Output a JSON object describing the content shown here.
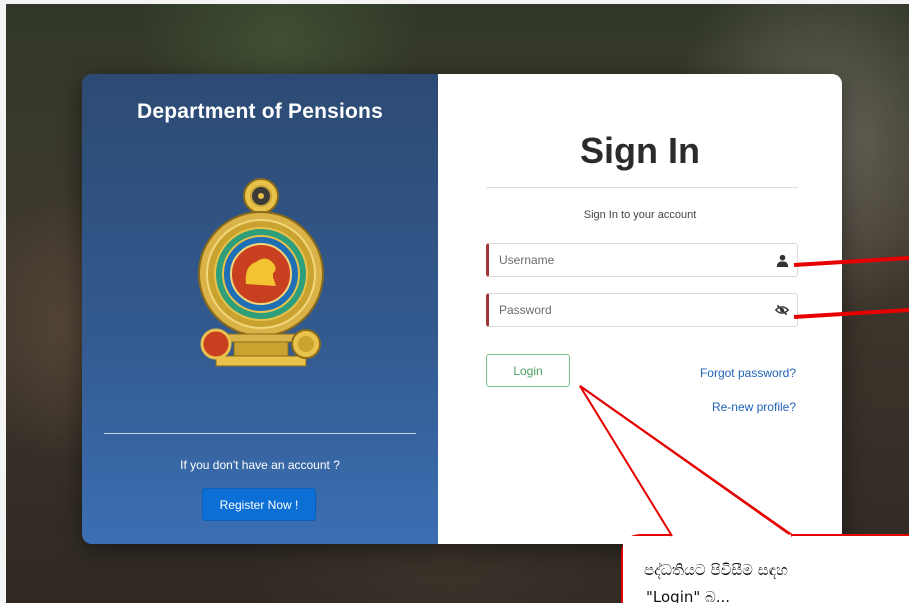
{
  "left_panel": {
    "title": "Department of Pensions",
    "no_account_text": "If you don't have an account ?",
    "register_label": "Register Now !"
  },
  "right_panel": {
    "title": "Sign In",
    "subtitle": "Sign In to your account",
    "username_placeholder": "Username",
    "password_placeholder": "Password",
    "login_label": "Login",
    "forgot_password_label": "Forgot password?",
    "renew_profile_label": "Re-new profile?"
  },
  "annotation": {
    "callout_text": "පද්ධතියට පිවිසීම සඳහ",
    "callout_text_line2": "\"Login\" බ..."
  },
  "icons": {
    "username": "user-icon",
    "password": "eye-slash-icon",
    "emblem": "sri-lanka-emblem"
  },
  "colors": {
    "panel_blue": "#335a8f",
    "register_blue": "#0b6fd6",
    "login_green": "#4aa060",
    "link_blue": "#1f62b8",
    "field_accent": "#a23636",
    "annotation_red": "#e60000"
  }
}
